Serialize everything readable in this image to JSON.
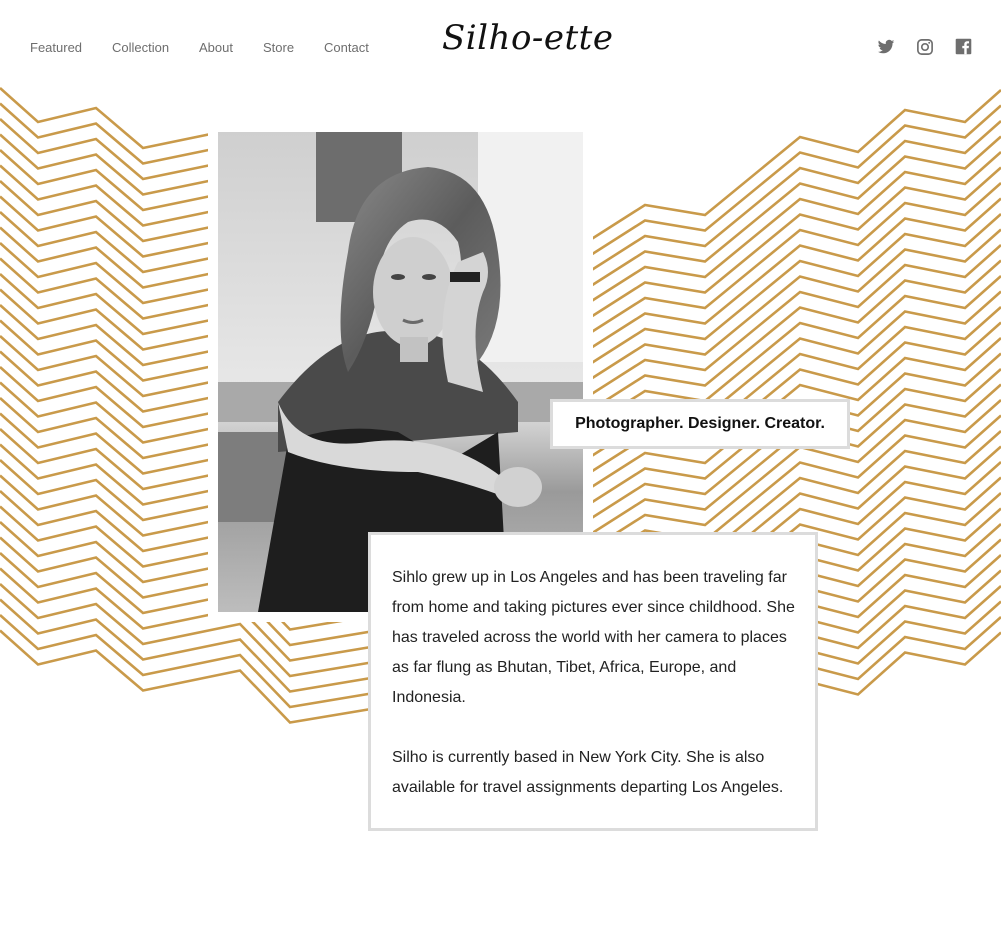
{
  "nav": {
    "links": [
      {
        "label": "Featured"
      },
      {
        "label": "Collection"
      },
      {
        "label": "About"
      },
      {
        "label": "Store"
      },
      {
        "label": "Contact"
      }
    ],
    "logo": "Silho-ette",
    "social": [
      "twitter-icon",
      "instagram-icon",
      "facebook-icon"
    ]
  },
  "profile": {
    "tagline": "Photographer. Designer. Creator.",
    "bio_paragraphs": [
      "Sihlo grew up in Los Angeles and has been traveling far from home and taking pictures ever since childhood. She has traveled across the world with her camera to places as far flung as Bhutan, Tibet, Africa, Europe, and Indonesia.",
      "Silho is currently based in New York City. She is also available for travel assignments departing Los Angeles."
    ]
  },
  "colors": {
    "accent": "#c99a4a",
    "nav_text": "#6e6e6e",
    "border": "#dcdcdc"
  }
}
